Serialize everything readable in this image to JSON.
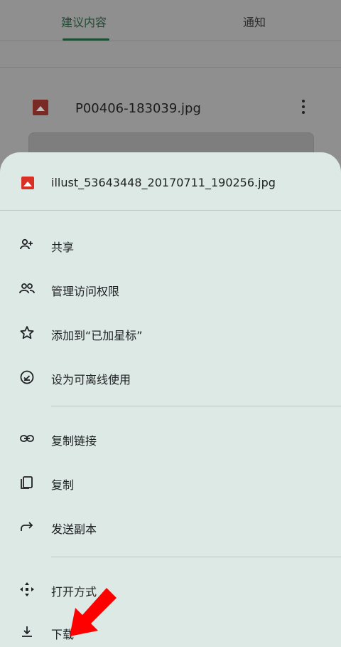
{
  "background": {
    "tabs": [
      {
        "label": "建议内容",
        "active": true
      },
      {
        "label": "通知",
        "active": false
      }
    ],
    "file": {
      "name": "P00406-183039.jpg"
    }
  },
  "sheet": {
    "file_name": "illust_53643448_20170711_190256.jpg",
    "items": [
      {
        "icon": "add-person-icon",
        "label": "共享"
      },
      {
        "icon": "people-icon",
        "label": "管理访问权限"
      },
      {
        "icon": "star-icon",
        "label": "添加到“已加星标”"
      },
      {
        "icon": "offline-icon",
        "label": "设为可离线使用"
      },
      {
        "icon": "link-icon",
        "label": "复制链接"
      },
      {
        "icon": "copy-icon",
        "label": "复制"
      },
      {
        "icon": "forward-icon",
        "label": "发送副本"
      },
      {
        "icon": "open-with-icon",
        "label": "打开方式"
      },
      {
        "icon": "download-icon",
        "label": "下载"
      }
    ]
  },
  "colors": {
    "sheet_bg": "#dde9e4",
    "accent": "#1d4f36",
    "image_icon": "#d93025",
    "annotation_arrow": "#ff0000"
  }
}
